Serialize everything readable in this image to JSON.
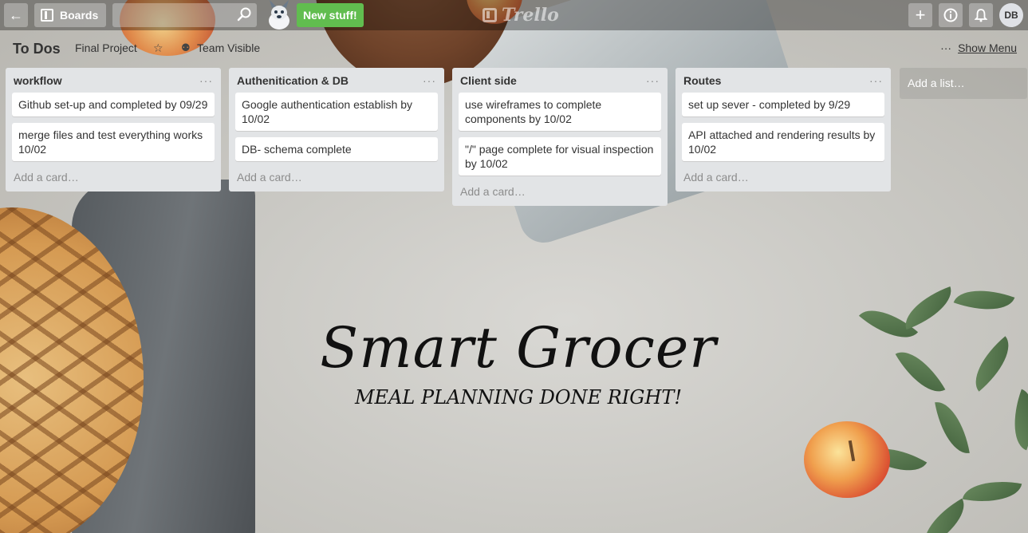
{
  "header": {
    "boards_label": "Boards",
    "new_stuff_label": "New stuff!",
    "logo_text": "Trello",
    "avatar_initials": "DB"
  },
  "board": {
    "title": "To Dos",
    "project": "Final Project",
    "visibility": "Team Visible",
    "menu_dots": "···",
    "show_menu": "Show Menu"
  },
  "lists": [
    {
      "title": "workflow",
      "menu": "···",
      "cards": [
        "Github set-up and completed by 09/29",
        "merge files and test everything works 10/02"
      ],
      "add_card": "Add a card…"
    },
    {
      "title": "Authenitication & DB",
      "menu": "···",
      "cards": [
        "Google authentication establish by 10/02",
        "DB- schema complete"
      ],
      "add_card": "Add a card…"
    },
    {
      "title": "Client side",
      "menu": "···",
      "cards": [
        "use wireframes to complete components by 10/02",
        "\"/\" page complete for visual inspection by 10/02"
      ],
      "add_card": "Add a card…"
    },
    {
      "title": "Routes",
      "menu": "···",
      "cards": [
        "set up sever - completed by 9/29",
        "API attached and rendering results by 10/02"
      ],
      "add_card": "Add a card…"
    }
  ],
  "add_list": "Add a list…",
  "hero": {
    "title": "Smart Grocer",
    "subtitle": "MEAL PLANNING DONE RIGHT!"
  },
  "colors": {
    "new_stuff_green": "#61bd4f",
    "list_bg": "#e2e4e6",
    "header_overlay": "rgba(0,0,0,0.32)"
  },
  "icons": [
    "back-arrow-icon",
    "boards-icon",
    "search-icon",
    "mascot-dog-icon",
    "trello-logo-icon",
    "plus-icon",
    "info-icon",
    "bell-icon",
    "star-icon",
    "team-icon"
  ]
}
